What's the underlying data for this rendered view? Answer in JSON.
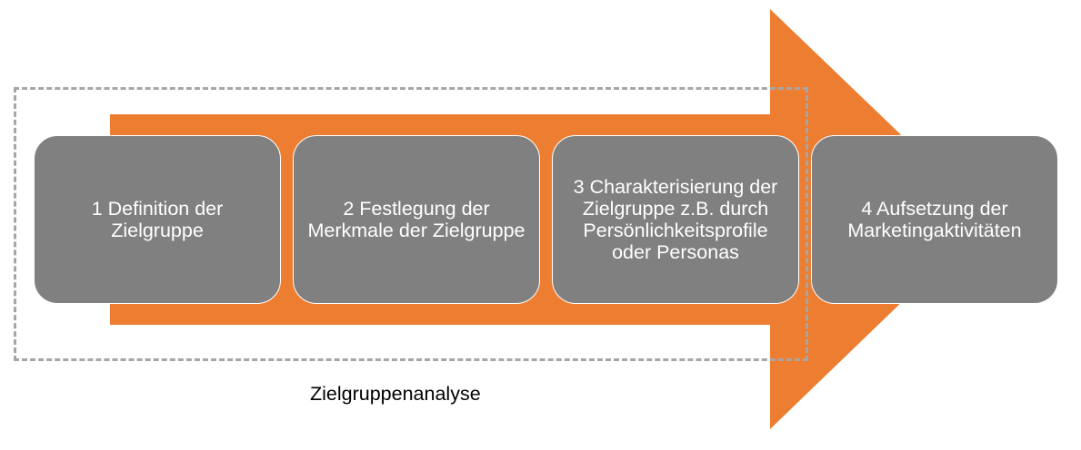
{
  "colors": {
    "arrow": "#ed7d31",
    "step_box": "#808080",
    "step_text": "#ffffff",
    "frame": "#a6a6a6"
  },
  "steps": [
    {
      "label": "1 Definition der Zielgruppe"
    },
    {
      "label": "2 Festlegung der Merkmale der Zielgruppe"
    },
    {
      "label": "3 Charakterisierung der Zielgruppe z.B. durch Persönlichkeitsprofile oder Personas"
    },
    {
      "label": "4 Aufsetzung der Marketingaktivitäten"
    }
  ],
  "analysis": {
    "label": "Zielgruppenanalyse"
  }
}
